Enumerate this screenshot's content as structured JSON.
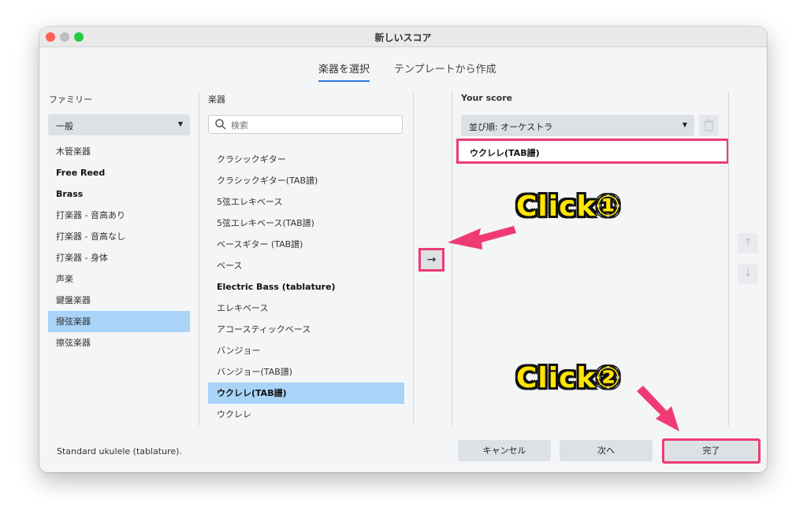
{
  "window": {
    "title": "新しいスコア"
  },
  "tabs": [
    {
      "label": "楽器を選択",
      "selected": true
    },
    {
      "label": "テンプレートから作成",
      "selected": false
    }
  ],
  "family": {
    "heading": "ファミリー",
    "dropdown_value": "一般",
    "items": [
      {
        "label": "木管楽器"
      },
      {
        "label": "Free Reed"
      },
      {
        "label": "Brass"
      },
      {
        "label": "打楽器 - 音高あり"
      },
      {
        "label": "打楽器 - 音高なし"
      },
      {
        "label": "打楽器 - 身体"
      },
      {
        "label": "声楽"
      },
      {
        "label": "鍵盤楽器"
      },
      {
        "label": "撥弦楽器",
        "selected": true
      },
      {
        "label": "擦弦楽器"
      }
    ]
  },
  "instruments": {
    "heading": "楽器",
    "search_placeholder": "検索",
    "items": [
      {
        "label": "クラシックギター"
      },
      {
        "label": "クラシックギター(TAB譜)"
      },
      {
        "label": "5弦エレキベース"
      },
      {
        "label": "5弦エレキベース(TAB譜)"
      },
      {
        "label": "ベースギター (TAB譜)"
      },
      {
        "label": "ベース"
      },
      {
        "label": "Electric Bass (tablature)"
      },
      {
        "label": "エレキベース"
      },
      {
        "label": "アコースティックベース"
      },
      {
        "label": "バンジョー"
      },
      {
        "label": "バンジョー(TAB譜)"
      },
      {
        "label": "ウクレレ(TAB譜)",
        "selected": true
      },
      {
        "label": "ウクレレ"
      }
    ]
  },
  "add_button": {
    "label": "→"
  },
  "score": {
    "heading": "Your score",
    "order_dropdown_value": "並び順: オーケストラ",
    "items": [
      {
        "label": "ウクレレ(TAB譜)"
      }
    ]
  },
  "move_buttons": {
    "up": "↑",
    "down": "↓"
  },
  "status_text": "Standard ukulele (tablature).",
  "buttons": {
    "cancel": "キャンセル",
    "next": "次へ",
    "done": "完了"
  },
  "annotations": {
    "click1": "Click①",
    "click2": "Click②"
  },
  "colors": {
    "highlight": "#ef3a73",
    "selection": "#a9d3f7",
    "annotation_text": "#ffe500"
  }
}
